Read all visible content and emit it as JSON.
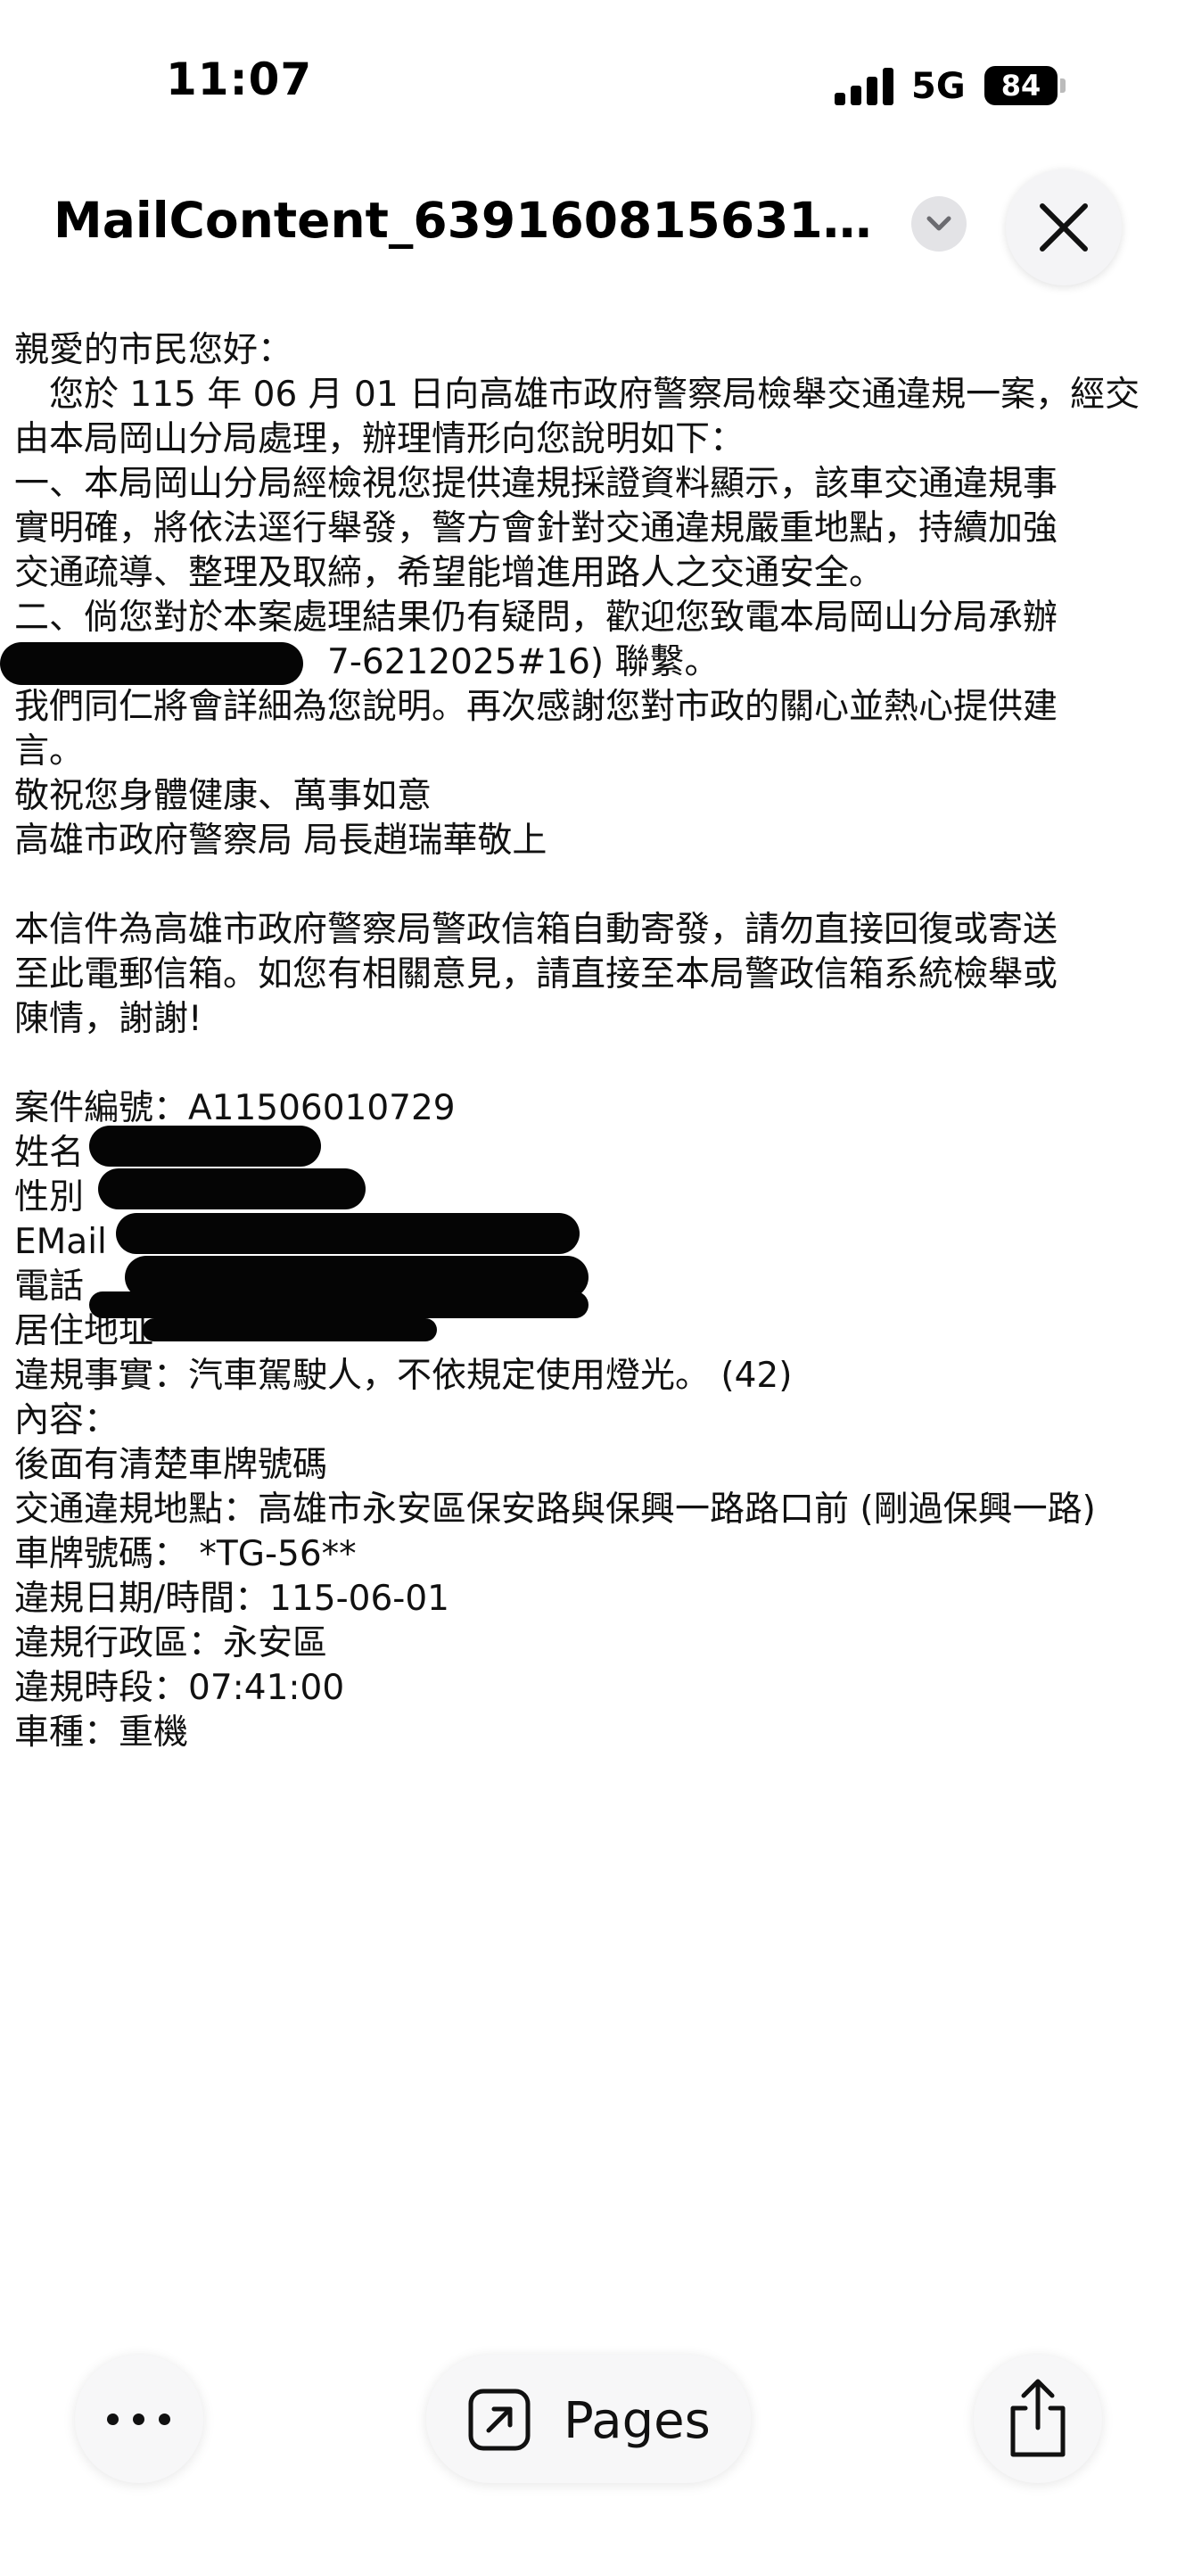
{
  "status_bar": {
    "time": "11:07",
    "network": "5G",
    "battery": "84"
  },
  "title_bar": {
    "title": "MailContent_6391608156313..."
  },
  "mail": {
    "lines": [
      "親愛的市民您好：",
      "　您於 115 年 06 月 01 日向高雄市政府警察局檢舉交通違規一案，經交",
      "由本局岡山分局處理，辦理情形向您說明如下：",
      "一、本局岡山分局經檢視您提供違規採證資料顯示，該車交通違規事",
      "實明確，將依法逕行舉發，警方會針對交通違規嚴重地點，持續加強",
      "交通疏導、整理及取締，希望能增進用路人之交通安全。",
      "二、倘您對於本案處理結果仍有疑問，歡迎您致電本局岡山分局承辦",
      "　　　　　　　　　7-6212025#16) 聯繫。",
      "我們同仁將會詳細為您說明。再次感謝您對市政的關心並熱心提供建",
      "言。",
      "敬祝您身體健康、萬事如意",
      "高雄市政府警察局 局長趙瑞華敬上",
      "",
      "本信件為高雄市政府警察局警政信箱自動寄發，請勿直接回復或寄送",
      "至此電郵信箱。如您有相關意見，請直接至本局警政信箱系統檢舉或",
      "陳情，謝謝!",
      "",
      "案件編號：A11506010729",
      "姓名",
      "性別",
      "EMail",
      "電話",
      "居住地址",
      "違規事實：汽車駕駛人，不依規定使用燈光。 (42)",
      "內容：",
      "後面有清楚車牌號碼",
      "交通違規地點：高雄市永安區保安路與保興一路路口前 (剛過保興一路)",
      "車牌號碼： *TG-56**",
      "違規日期/時間：115-06-01",
      "違規行政區：永安區",
      "違規時段：07:41:00",
      "車種：重機"
    ]
  },
  "bottom_bar": {
    "pages_label": "Pages"
  },
  "icons": {
    "more": "more-dots-icon",
    "pages": "open-external-icon",
    "share": "share-icon",
    "close": "close-icon",
    "chevron": "chevron-down-icon"
  }
}
